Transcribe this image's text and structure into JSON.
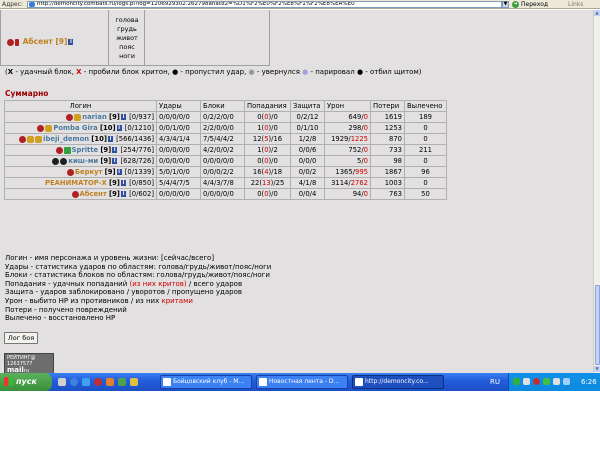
{
  "browser": {
    "address_label": "Адрес:",
    "url": "http://demoncity.combats.ru/logs.pl?log=1206929302.262798analiz2=%D1%F2%E0%F2%E8%F1%F2%E8%EA%E0",
    "go_label": "Переход",
    "links_label": "Links"
  },
  "top_fragment": {
    "player_name": "Абсент [9]",
    "zones": [
      "голова",
      "грудь",
      "живот",
      "пояс",
      "ноги"
    ]
  },
  "legend": {
    "x_black": "X",
    "t1": " - удачный блок, ",
    "x_red": "X",
    "t2": " - пробили блок критон, ",
    "dot": "●",
    "t3": " - пропустил удар, ",
    "dot2": "●",
    "t4": " - увернулся ",
    "dot3": "●",
    "t5": " - парировал ",
    "dot4": "●",
    "t6": " - отбил щитом)",
    "open": "("
  },
  "summary": {
    "title": "Суммарно",
    "headers": [
      "Логин",
      "Удары",
      "Блоки",
      "Попадания",
      "Защита",
      "Урон",
      "Потери",
      "Вылечено"
    ],
    "rows": [
      {
        "name": "narian",
        "level": "[9]",
        "hp": "[0/937]",
        "name_color": "#4a7aa0",
        "hits": "0/0/0/0/0",
        "blocks": "0/2/2/0/0",
        "pop_a": "0",
        "pop_b": "0",
        "pop_c": "0",
        "defense": "0/2/12",
        "dmg_a": "649",
        "dmg_b": "0",
        "losses": "1619",
        "healed": "189"
      },
      {
        "name": "Pomba Gira",
        "level": "[10]",
        "hp": "[0/1210]",
        "name_color": "#4a7aa0",
        "hits": "0/0/1/0/0",
        "blocks": "2/2/0/0/0",
        "pop_a": "1",
        "pop_b": "0",
        "pop_c": "0",
        "defense": "0/1/10",
        "dmg_a": "298",
        "dmg_b": "0",
        "losses": "1253",
        "healed": "0"
      },
      {
        "name": "ibeji_demon",
        "level": "[10]",
        "hp": "[566/1436]",
        "name_color": "#4a7aa0",
        "hits": "4/3/4/1/4",
        "blocks": "7/5/4/4/2",
        "pop_a": "12",
        "pop_b": "5",
        "pop_c": "16",
        "defense": "1/2/8",
        "dmg_a": "1929",
        "dmg_b": "1225",
        "losses": "870",
        "healed": "0"
      },
      {
        "name": "Spritte",
        "level": "[9]",
        "hp": "[254/776]",
        "name_color": "#4a7aa0",
        "hits": "0/0/0/0/0",
        "blocks": "4/2/0/0/2",
        "pop_a": "1",
        "pop_b": "0",
        "pop_c": "2",
        "defense": "0/0/6",
        "dmg_a": "752",
        "dmg_b": "0",
        "losses": "733",
        "healed": "211"
      },
      {
        "name": "киш-ми",
        "level": "[9]",
        "hp": "[628/726]",
        "name_color": "#4a7aa0",
        "hits": "0/0/0/0/0",
        "blocks": "0/0/0/0/0",
        "pop_a": "0",
        "pop_b": "0",
        "pop_c": "0",
        "defense": "0/0/0",
        "dmg_a": "5",
        "dmg_b": "0",
        "losses": "98",
        "healed": "0"
      },
      {
        "name": "Беркут",
        "level": "[9]",
        "hp": "[0/1339]",
        "name_color": "#c08020",
        "hits": "5/0/1/0/0",
        "blocks": "0/0/0/2/2",
        "pop_a": "16",
        "pop_b": "4",
        "pop_c": "18",
        "defense": "0/0/2",
        "dmg_a": "1365",
        "dmg_b": "995",
        "losses": "1867",
        "healed": "96"
      },
      {
        "name": "РЕАНИМАТОР-Х",
        "level": "[9]",
        "hp": "[0/850]",
        "name_color": "#c08020",
        "hits": "5/4/4/7/5",
        "blocks": "4/4/3/7/8",
        "pop_a": "22",
        "pop_b": "13",
        "pop_c": "25",
        "defense": "4/1/8",
        "dmg_a": "3114",
        "dmg_b": "2762",
        "losses": "1003",
        "healed": "0"
      },
      {
        "name": "Абсент",
        "level": "[9]",
        "hp": "[0/602]",
        "name_color": "#c08020",
        "hits": "0/0/0/0/0",
        "blocks": "0/0/0/0/0",
        "pop_a": "0",
        "pop_b": "0",
        "pop_c": "0",
        "defense": "0/0/4",
        "dmg_a": "94",
        "dmg_b": "0",
        "losses": "763",
        "healed": "50"
      }
    ]
  },
  "notes": {
    "n1": "Логин - имя персонажа и уровень жизни: [сейчас/всего]",
    "n2": "Удары - статистика ударов по областям: голова/грудь/живот/пояс/ноги",
    "n3": "Блоки - статистика блоков по областям: голова/грудь/живот/пояс/ноги",
    "n4a": "Попадания - удачных попаданий ",
    "n4b": "(из них критов)",
    "n4c": " / всего ударов",
    "n5": "Защита - ударов заблокировано / уворотов / пропущено ударов",
    "n6a": "Урон - выбито HP из противников / из них ",
    "n6b": "критами",
    "n7": "Потери - получено повреждений",
    "n8": "Вылечено - восстановлено HP"
  },
  "log_button": "Лог боя",
  "counter": {
    "line1": "РЕЙТИНГ@ 12637577",
    "brand": "mail",
    "suffix": "ru"
  },
  "taskbar": {
    "start": "пуск",
    "tasks": [
      "Бойцовский клуб - М...",
      "Новостная лента - D...",
      "http://demoncity.co..."
    ],
    "lang": "RU",
    "clock": "6:26"
  }
}
